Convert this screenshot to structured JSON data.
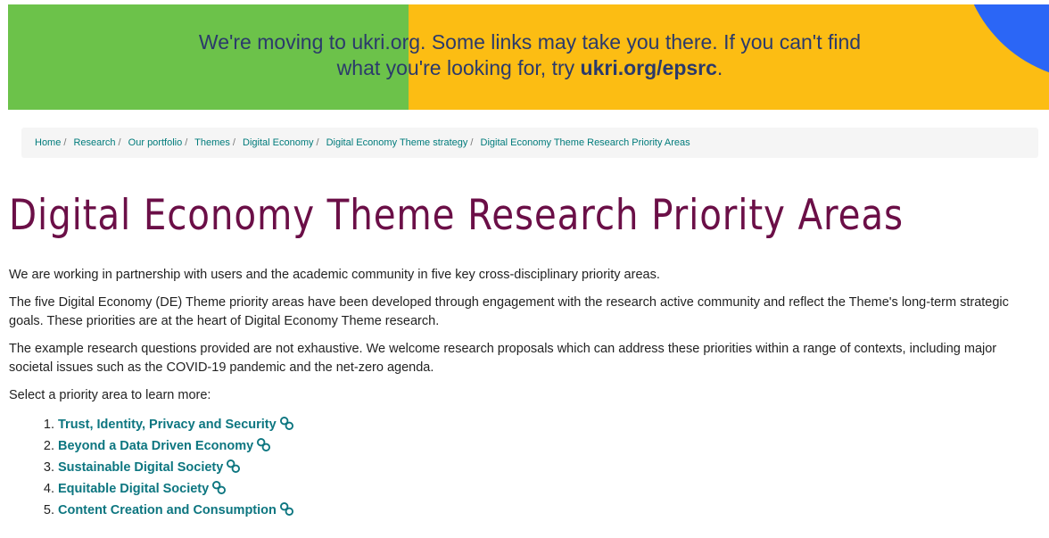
{
  "banner": {
    "line1": "We're moving to ukri.org. Some links may take you there. If you can't find",
    "line2_prefix": "what you're looking for, try ",
    "line2_link": "ukri.org/epsrc",
    "line2_suffix": ".",
    "colors": {
      "green": "#6cc24a",
      "yellow": "#fcbd13",
      "blue": "#2b66f6"
    }
  },
  "breadcrumb": [
    "Home",
    "Research",
    "Our portfolio",
    "Themes",
    "Digital Economy",
    "Digital Economy Theme strategy",
    "Digital Economy Theme Research Priority Areas"
  ],
  "breadcrumb_separator": "/",
  "page_title": "Digital Economy Theme Research Priority Areas",
  "paragraphs": [
    "We are working in partnership with users and the academic community in five key cross-disciplinary priority areas.",
    "The five Digital Economy (DE) Theme priority areas have been developed through engagement with the research active community and reflect the Theme's long-term strategic goals. These priorities are at the heart of Digital Economy Theme research.",
    "The example research questions provided are not exhaustive. We welcome research proposals which can address these priorities within a range of contexts, including major societal issues such as the COVID-19 pandemic and the net-zero agenda.",
    "Select a priority area to learn more:"
  ],
  "priority_areas": [
    "Trust, Identity, Privacy and Security",
    "Beyond a Data Driven Economy",
    "Sustainable Digital Society",
    "Equitable Digital Society",
    "Content Creation and Consumption"
  ],
  "icons": {
    "link": "chain-link-icon"
  },
  "colors": {
    "title": "#6b0f47",
    "link": "#0d7680",
    "breadcrumb_link": "#007b7b"
  }
}
